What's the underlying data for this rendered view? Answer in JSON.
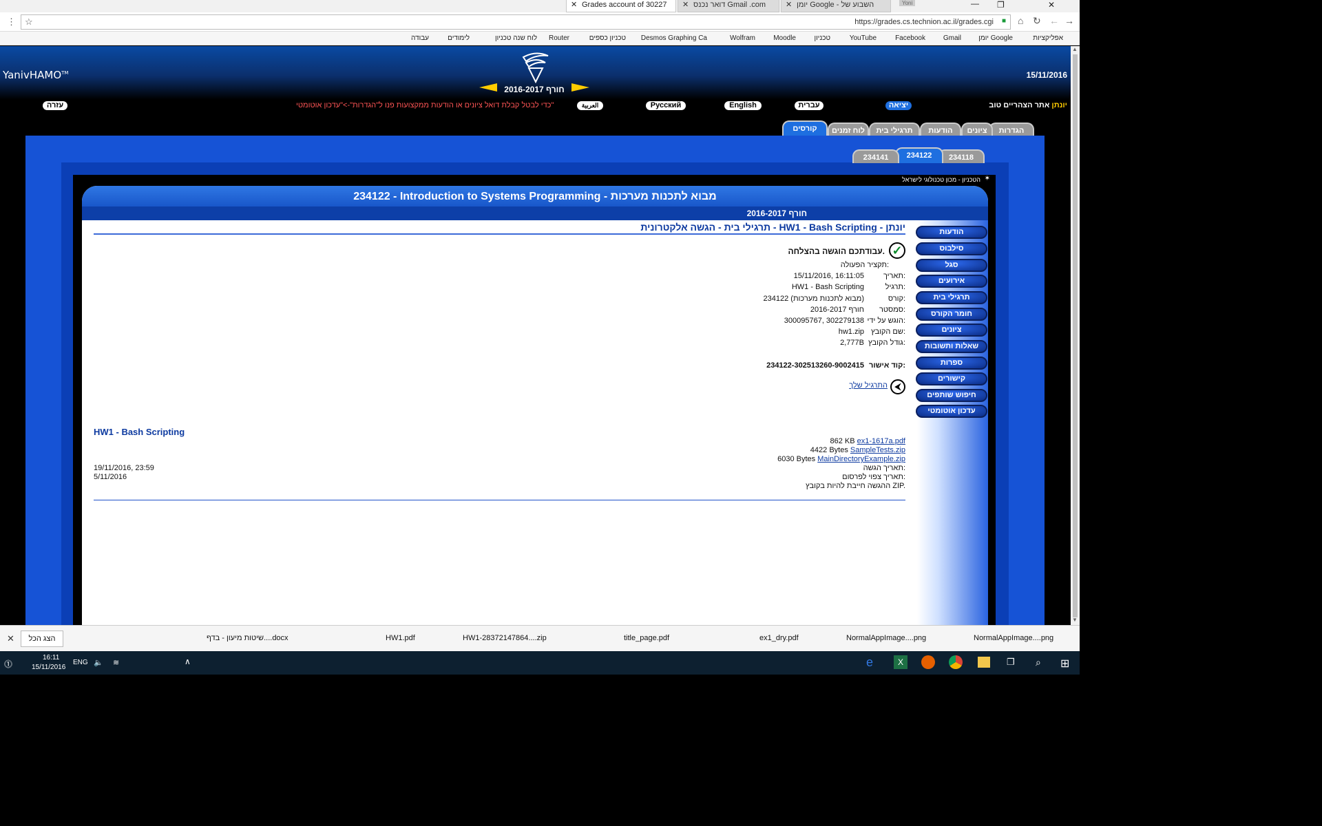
{
  "browser": {
    "tabs": [
      {
        "title": "Grades account of 30227",
        "active": true
      },
      {
        "title": "דואר נכנס Gmail .com",
        "active": false
      },
      {
        "title": "יומן Google - השבוע של",
        "active": false
      }
    ],
    "profile": "Yoni",
    "url": "https://grades.cs.technion.ac.il/grades.cgi",
    "bookmarks": [
      "אפליקציות",
      "יומן Google",
      "Gmail",
      "Facebook",
      "YouTube",
      "טכניון",
      "Moodle",
      "Wolfram",
      "Desmos Graphing Ca",
      "טכניון כספים",
      "Router",
      "לוח שנה טכניון",
      "לימודים",
      "עבודה"
    ]
  },
  "header": {
    "logo": "YanivHAMO",
    "logo_tm": "TM",
    "date": "15/11/2016",
    "semester": "חורף 2016-2017",
    "user_label": "אתר הצהריים טוב",
    "user_name": "יונתן",
    "exit": "יציאה",
    "langs": [
      "עברית",
      "English",
      "Русский",
      "العربية"
    ],
    "notice": "כדי לבטל קבלת דואל ציונים או הודעות ממקצועות פנו ל\"הגדרות\"->\"עדכון אוטומטי\"",
    "help": "עזרה"
  },
  "main_tabs": [
    "הגדרות",
    "ציונים",
    "הודעות",
    "תרגילי בית",
    "לוח זמנים",
    "קורסים"
  ],
  "course_tabs": [
    "234118",
    "234122",
    "234141"
  ],
  "institution": "הטכניון - מכון טכנולוגי לישראל",
  "course_title": "234122 - Introduction to Systems Programming - מבוא לתכנות מערכות",
  "course_semester": "חורף 2016-2017",
  "page_heading": "תרגילי בית - הגשה אלקטרונית - HW1 - Bash Scripting - יונתן",
  "side_menu": [
    "הודעות",
    "סילבוס",
    "סגל",
    "אירועים",
    "תרגילי בית",
    "חומר הקורס",
    "ציונים",
    "שאלות ותשובות",
    "ספרות",
    "קישורים",
    "חיפוש שותפים",
    "עדכון אוטומטי"
  ],
  "submission": {
    "success": "עבודתכם הוגשה בהצלחה.",
    "summary_label": "תקציר הפעולה:",
    "rows": [
      {
        "label": "תאריך:",
        "value": "15/11/2016, 16:11:05"
      },
      {
        "label": "תרגיל:",
        "value": "HW1 - Bash Scripting"
      },
      {
        "label": "קורס:",
        "value": "234122 (מבוא לתכנות מערכות)"
      },
      {
        "label": "סמסטר:",
        "value": "חורף 2016-2017"
      },
      {
        "label": "הוגש על ידי:",
        "value": "300095767, 302279138"
      },
      {
        "label": "שם הקובץ:",
        "value": "hw1.zip"
      },
      {
        "label": "גודל הקובץ:",
        "value": "2,777B"
      }
    ],
    "code_label": "קוד אישור:",
    "code_value": "234122-302513260-9002415",
    "back_link": "התרגיל שלך"
  },
  "hw": {
    "title": "HW1 - Bash Scripting",
    "files": [
      {
        "name": "ex1-1617a.pdf",
        "size": "862 KB"
      },
      {
        "name": "SampleTests.zip",
        "size": "4422 Bytes"
      },
      {
        "name": "MainDirectoryExample.zip",
        "size": "6030 Bytes"
      }
    ],
    "due_label": "תאריך הגשה:",
    "due_value": "19/11/2016, 23:59",
    "pub_label": "תאריך צפוי לפרסום:",
    "pub_value": "5/11/2016",
    "note": "ההגשה חייבת להיות בקובץ ZIP."
  },
  "downloads": {
    "show_all": "הצג הכל",
    "items": [
      "שיטות מיעון - בדף....docx",
      "HW1.pdf",
      "HW1-28372147864....zip",
      "title_page.pdf",
      "ex1_dry.pdf",
      "NormalAppImage....png",
      "NormalAppImage....png"
    ]
  },
  "taskbar": {
    "time": "16:11",
    "date": "15/11/2016",
    "lang": "ENG"
  }
}
